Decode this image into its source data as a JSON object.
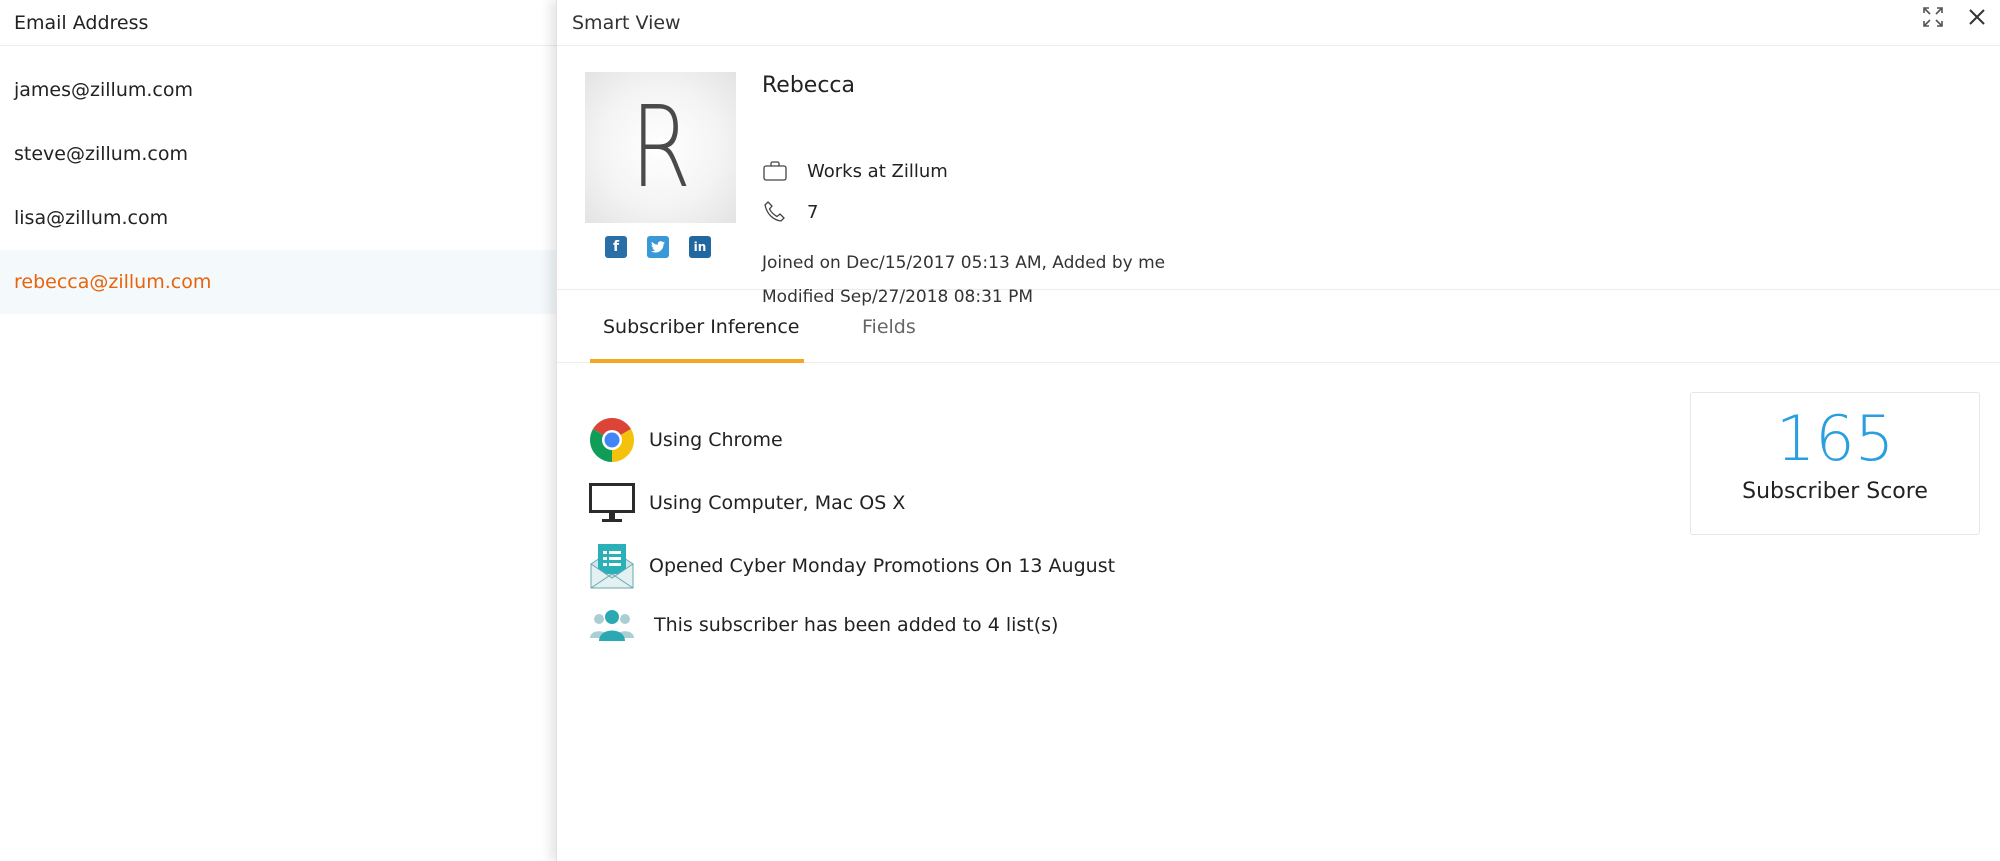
{
  "list": {
    "header": "Email Address",
    "emails": [
      "james@zillum.com",
      "steve@zillum.com",
      "lisa@zillum.com",
      "rebecca@zillum.com"
    ],
    "selected_index": 3
  },
  "panel": {
    "title": "Smart View",
    "icons": {
      "expand": "expand-icon",
      "close": "close-icon"
    },
    "profile": {
      "avatar_letter": "R",
      "name": "Rebecca",
      "company": "Works at Zillum",
      "phone": "7",
      "joined": "Joined on Dec/15/2017 05:13 AM, Added by me",
      "modified": "Modified Sep/27/2018 08:31 PM",
      "socials": [
        "facebook-icon",
        "twitter-icon",
        "linkedin-icon"
      ]
    },
    "tabs": [
      {
        "label": "Subscriber Inference",
        "active": true
      },
      {
        "label": "Fields",
        "active": false
      }
    ],
    "inferences": [
      {
        "icon": "chrome-icon",
        "text": "Using Chrome"
      },
      {
        "icon": "computer-icon",
        "text": "Using Computer, Mac OS X"
      },
      {
        "icon": "email-opened-icon",
        "text": "Opened Cyber Monday Promotions On 13 August"
      },
      {
        "icon": "lists-icon",
        "text": "This subscriber has been added to 4 list(s)"
      }
    ],
    "score": {
      "value": "165",
      "label": "Subscriber Score"
    }
  },
  "colors": {
    "selected_email": "#e8640c",
    "selected_row_bg": "#f4f9fc",
    "tab_accent": "#f5a623",
    "score": "#2a9fe0"
  }
}
